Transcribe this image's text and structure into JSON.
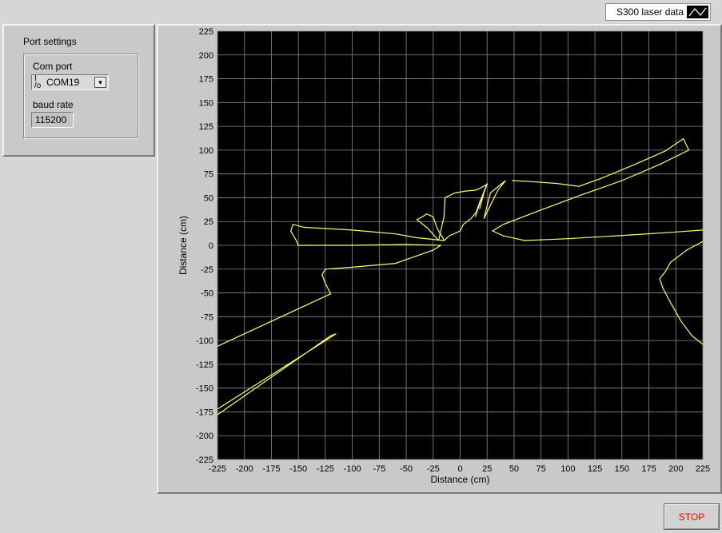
{
  "port_settings": {
    "title": "Port settings",
    "com_port_label": "Com port",
    "com_port_value": "COM19",
    "io_icon": "I/O",
    "baud_label": "baud rate",
    "baud_value": "115200"
  },
  "legend": {
    "label": "S300 laser data",
    "icon": "line-plot-icon"
  },
  "stop_button": {
    "label": "STOP"
  },
  "colors": {
    "trace": "#ffff66",
    "plot_background": "#000000",
    "grid": "#8a8a8a",
    "stop_text": "#ff0000"
  },
  "chart_data": {
    "type": "line",
    "title": "",
    "xlabel": "Distance (cm)",
    "ylabel": "Distance (cm)",
    "xlim": [
      -225,
      225
    ],
    "ylim": [
      -225,
      225
    ],
    "xticks": [
      -225,
      -200,
      -175,
      -150,
      -125,
      -100,
      -75,
      -50,
      -25,
      0,
      25,
      50,
      75,
      100,
      125,
      150,
      175,
      200,
      225
    ],
    "yticks": [
      225,
      200,
      175,
      150,
      125,
      100,
      75,
      50,
      25,
      0,
      -25,
      -50,
      -75,
      -100,
      -125,
      -150,
      -175,
      -200,
      -225
    ],
    "grid": true,
    "series": [
      {
        "segments": [
          [
            [
              -225,
              -106
            ],
            [
              -120,
              -51
            ],
            [
              -125,
              -40
            ],
            [
              -128,
              -31
            ],
            [
              -125,
              -25
            ],
            [
              -100,
              -23
            ],
            [
              -60,
              -19
            ],
            [
              -25,
              -5
            ],
            [
              -18,
              0
            ],
            [
              -50,
              1
            ],
            [
              -100,
              0
            ],
            [
              -150,
              0
            ],
            [
              -152,
              5
            ],
            [
              -157,
              15
            ],
            [
              -155,
              22
            ],
            [
              -145,
              19
            ],
            [
              -100,
              16
            ],
            [
              -60,
              12
            ],
            [
              -40,
              8
            ],
            [
              -15,
              5
            ],
            [
              -16,
              8
            ],
            [
              -20,
              15
            ],
            [
              -22,
              20
            ],
            [
              -25,
              30
            ],
            [
              -31,
              33
            ],
            [
              -35,
              30
            ],
            [
              -40,
              27
            ],
            [
              -30,
              18
            ],
            [
              -20,
              5
            ]
          ],
          [
            [
              -20,
              5
            ],
            [
              -18,
              15
            ],
            [
              -15,
              30
            ],
            [
              -14,
              50
            ],
            [
              -5,
              55
            ],
            [
              5,
              57
            ],
            [
              15,
              58
            ],
            [
              25,
              64
            ],
            [
              18,
              45
            ],
            [
              15,
              35
            ],
            [
              10,
              28
            ],
            [
              3,
              22
            ],
            [
              0,
              15
            ],
            [
              -10,
              10
            ],
            [
              -15,
              5
            ]
          ],
          [
            [
              14,
              30
            ],
            [
              20,
              50
            ],
            [
              25,
              65
            ],
            [
              22,
              55
            ],
            [
              18,
              38
            ]
          ],
          [
            [
              22,
              28
            ],
            [
              35,
              58
            ],
            [
              42,
              68
            ],
            [
              28,
              55
            ],
            [
              22,
              28
            ]
          ],
          [
            [
              48,
              68
            ],
            [
              65,
              67
            ],
            [
              90,
              65
            ],
            [
              110,
              62
            ],
            [
              130,
              70
            ],
            [
              160,
              84
            ],
            [
              190,
              99
            ],
            [
              203,
              109
            ],
            [
              207,
              112
            ],
            [
              212,
              100
            ],
            [
              185,
              85
            ],
            [
              150,
              68
            ],
            [
              110,
              52
            ],
            [
              70,
              35
            ],
            [
              40,
              22
            ],
            [
              30,
              15
            ],
            [
              40,
              10
            ],
            [
              60,
              5
            ],
            [
              100,
              7
            ],
            [
              160,
              11
            ],
            [
              200,
              14
            ],
            [
              225,
              16
            ]
          ],
          [
            [
              225,
              4
            ],
            [
              210,
              -5
            ],
            [
              195,
              -18
            ],
            [
              190,
              -28
            ],
            [
              185,
              -35
            ],
            [
              188,
              -45
            ],
            [
              195,
              -60
            ],
            [
              205,
              -80
            ],
            [
              215,
              -95
            ],
            [
              225,
              -104
            ]
          ],
          [
            [
              -225,
              -172
            ],
            [
              -115,
              -93
            ],
            [
              -120,
              -95
            ],
            [
              -225,
              -178
            ]
          ]
        ]
      }
    ]
  }
}
